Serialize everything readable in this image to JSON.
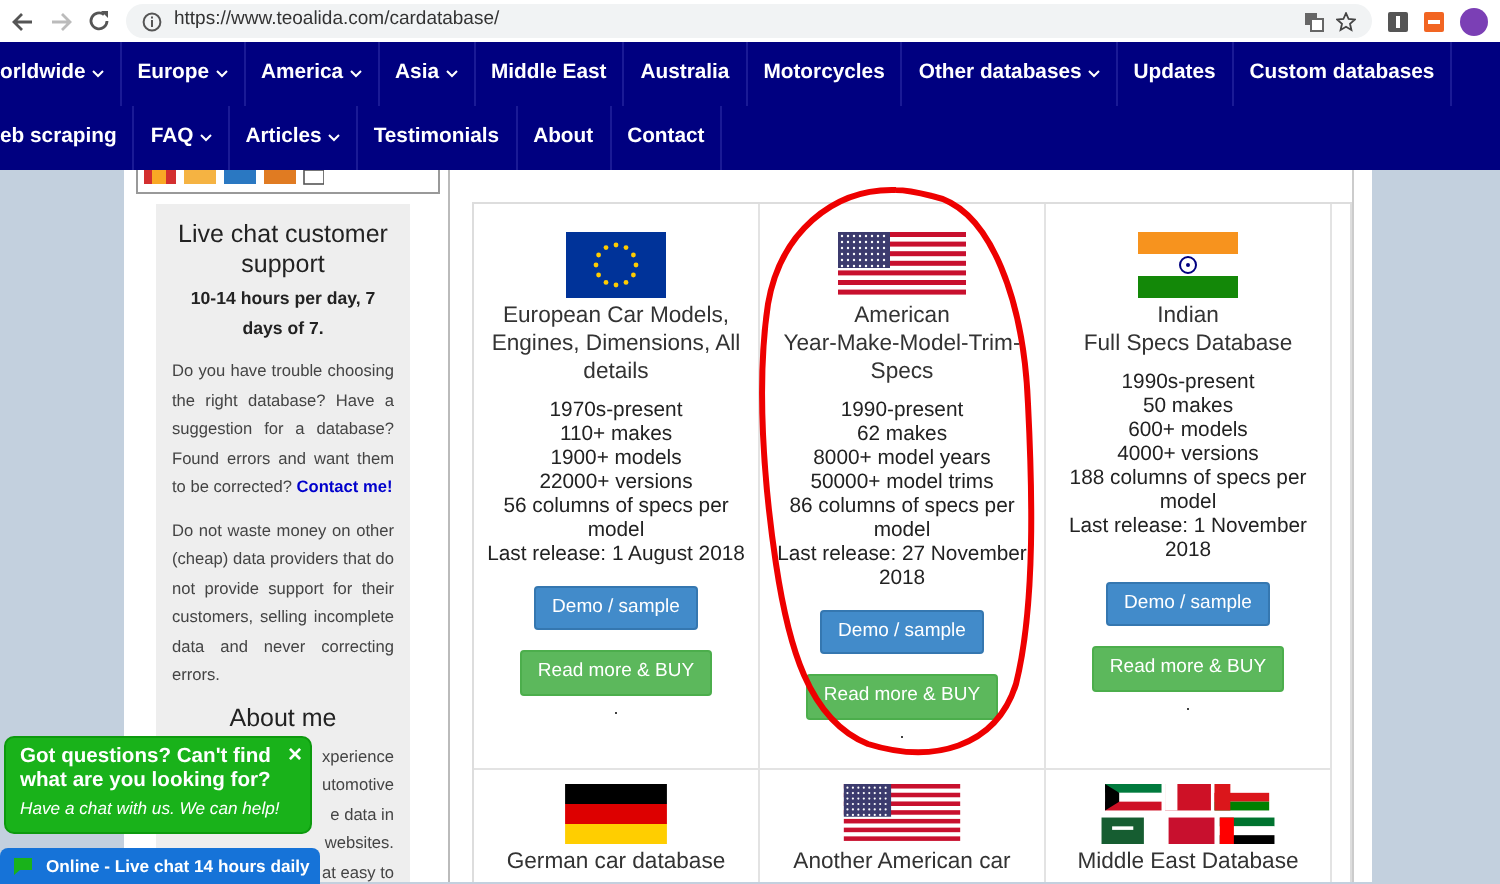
{
  "browser": {
    "url": "https://www.teoalida.com/cardatabase/"
  },
  "nav": {
    "rows": [
      [
        {
          "label": "orldwide",
          "dropdown": true
        },
        {
          "label": "Europe",
          "dropdown": true
        },
        {
          "label": "America",
          "dropdown": true
        },
        {
          "label": "Asia",
          "dropdown": true
        },
        {
          "label": "Middle East",
          "dropdown": false
        },
        {
          "label": "Australia",
          "dropdown": false
        },
        {
          "label": "Motorcycles",
          "dropdown": false
        },
        {
          "label": "Other databases",
          "dropdown": true
        },
        {
          "label": "Updates",
          "dropdown": false
        },
        {
          "label": "Custom databases",
          "dropdown": false
        }
      ],
      [
        {
          "label": "eb scraping",
          "dropdown": false
        },
        {
          "label": "FAQ",
          "dropdown": true
        },
        {
          "label": "Articles",
          "dropdown": true
        },
        {
          "label": "Testimonials",
          "dropdown": false
        },
        {
          "label": "About",
          "dropdown": false
        },
        {
          "label": "Contact",
          "dropdown": false
        }
      ]
    ]
  },
  "sidebar": {
    "heading": "Live chat customer support",
    "hours": "10-14 hours per day, 7 days of 7.",
    "paragraphs": [
      {
        "text": "Do you have trouble choosing the right database? Have a suggestion for a database? Found errors and want them to be corrected?",
        "link": "Contact me!"
      },
      {
        "text": "Do not waste money on other (cheap) data providers that do not provide support for their customers, selling incomplete data and never correcting errors."
      }
    ],
    "about_heading": "About me",
    "about_lines": [
      "xperience",
      "utomotive",
      "e data in",
      "websites.",
      "at easy to"
    ]
  },
  "databases": [
    {
      "kind": "eu",
      "title": [
        "European Car Models, Engines, Dimensions, All details"
      ],
      "stats": [
        "1970s-present",
        "110+ makes",
        "1900+ models",
        "22000+ versions",
        "56 columns of specs per model",
        "Last release: 1 August 2018"
      ],
      "demo": "Demo / sample",
      "buy": "Read more & BUY",
      "note": ".",
      "highlighted": false
    },
    {
      "kind": "us",
      "title": [
        "American",
        "Year-Make-Model-Trim-Specs"
      ],
      "stats": [
        "1990-present",
        "62 makes",
        "8000+ model years",
        "50000+ model trims",
        "86 columns of specs per model",
        "Last release: 27 November 2018"
      ],
      "demo": "Demo / sample",
      "buy": "Read more & BUY",
      "note": ".",
      "highlighted": true
    },
    {
      "kind": "in",
      "title": [
        "Indian",
        "Full Specs Database"
      ],
      "stats": [
        "1990s-present",
        "50 makes",
        "600+ models",
        "4000+ versions",
        "188 columns of specs per model",
        "Last release: 1 November 2018"
      ],
      "demo": "Demo / sample",
      "buy": "Read more & BUY",
      "note": ".",
      "highlighted": false
    },
    {
      "kind": "de",
      "title": [
        "German car database"
      ],
      "highlighted": false
    },
    {
      "kind": "us",
      "title": [
        "Another American car"
      ],
      "highlighted": false
    },
    {
      "kind": "me",
      "title": [
        "Middle East Database"
      ],
      "highlighted": false
    }
  ],
  "chat": {
    "title": "Got questions? Can't find what are you looking for?",
    "subtitle": "Have a chat with us. We can help!",
    "close": "×",
    "status": "Online - Live chat 14 hours daily"
  }
}
